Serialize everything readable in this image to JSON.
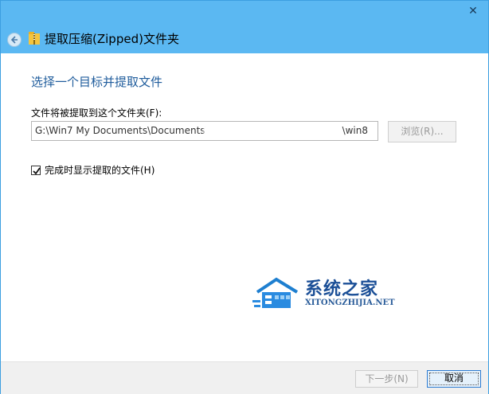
{
  "window": {
    "title": "提取压缩(Zipped)文件夹",
    "close_glyph": "✕"
  },
  "main": {
    "heading": "选择一个目标并提取文件",
    "destination_label": "文件将被提取到这个文件夹(F):",
    "path_value_start": "G:\\Win7 My Documents\\Documents\\",
    "path_value_end": "\\win8",
    "browse_label": "浏览(R)...",
    "show_files_label": "完成时显示提取的文件(H)",
    "show_files_checked": true
  },
  "watermark": {
    "cn": "系统之家",
    "en": "XITONGZHIJIA.NET"
  },
  "footer": {
    "next_label": "下一步(N)",
    "cancel_label": "取消"
  },
  "colors": {
    "titlebar": "#5bb8f2",
    "heading": "#1f5c9c",
    "watermark": "#1b4f97"
  },
  "icons": [
    "back-arrow-icon",
    "zip-folder-icon",
    "close-icon",
    "checkmark-icon",
    "house-logo-icon"
  ]
}
